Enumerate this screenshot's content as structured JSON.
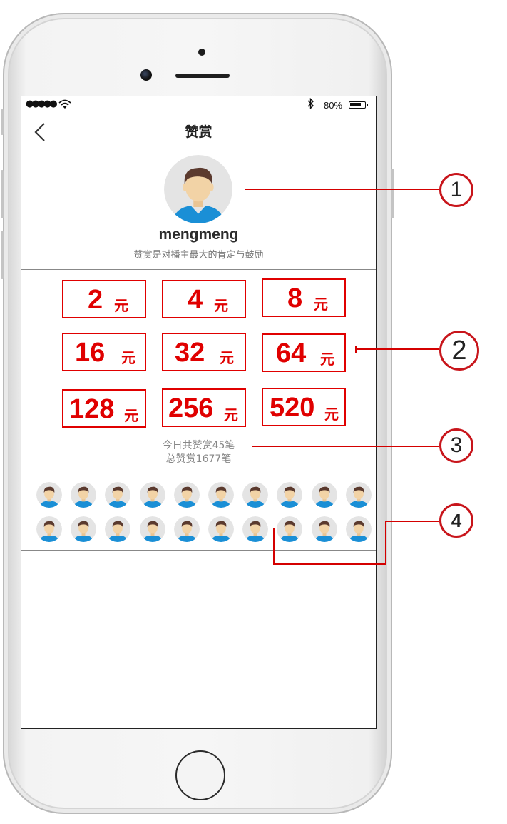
{
  "status_bar": {
    "signal": "●●●●●",
    "battery_percent": "80%",
    "battery_level": 0.8,
    "bluetooth_icon": "bluetooth-icon",
    "wifi_icon": "wifi-icon"
  },
  "header": {
    "title": "赞赏",
    "back_icon": "chevron-left-icon"
  },
  "profile": {
    "username": "mengmeng",
    "tagline": "赞赏是对播主最大的肯定与鼓励"
  },
  "amounts": [
    {
      "value": "2",
      "unit": "元"
    },
    {
      "value": "4",
      "unit": "元"
    },
    {
      "value": "8",
      "unit": "元"
    },
    {
      "value": "16",
      "unit": "元"
    },
    {
      "value": "32",
      "unit": "元"
    },
    {
      "value": "64",
      "unit": "元"
    },
    {
      "value": "128",
      "unit": "元"
    },
    {
      "value": "256",
      "unit": "元"
    },
    {
      "value": "520",
      "unit": "元"
    }
  ],
  "stats": {
    "today": "今日共赞赏45笔",
    "total": "总赞赏1677笔"
  },
  "supporters_count_shown": 20,
  "annotations": [
    "1",
    "2",
    "3",
    "4"
  ],
  "colors": {
    "accent_red": "#e00000",
    "annotation_red": "#c8151b",
    "avatar_hair": "#5b3a2e",
    "avatar_skin": "#f2d3a6",
    "avatar_shirt": "#1a8fd6",
    "avatar_bg": "#e4e4e4"
  }
}
